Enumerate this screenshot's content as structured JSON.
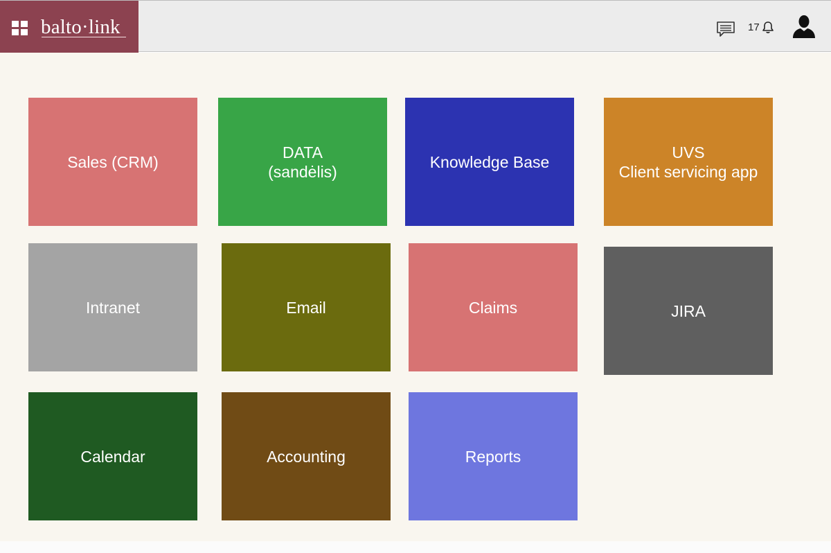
{
  "header": {
    "brand_color": "#8c4250",
    "logo_text": "balto·link",
    "menu_icon": "grid-icon",
    "messages_icon": "chat-icon",
    "notifications": {
      "count": "17",
      "icon": "bell-icon"
    },
    "user_icon": "user-avatar-icon"
  },
  "tiles": [
    {
      "label": "Sales (CRM)",
      "color": "#d77373"
    },
    {
      "label": "DATA\n(sandėlis)",
      "color": "#38a547"
    },
    {
      "label": "Knowledge Base",
      "color": "#2c33b1"
    },
    {
      "label": "UVS\nClient servicing app",
      "color": "#cc8428"
    },
    {
      "label": "Intranet",
      "color": "#a4a4a4"
    },
    {
      "label": "Email",
      "color": "#6b6b0e"
    },
    {
      "label": "Claims",
      "color": "#d77373"
    },
    {
      "label": "JIRA",
      "color": "#5f5f5f"
    },
    {
      "label": "Calendar",
      "color": "#1f5a22"
    },
    {
      "label": "Accounting",
      "color": "#704b15"
    },
    {
      "label": "Reports",
      "color": "#6e76df"
    }
  ]
}
